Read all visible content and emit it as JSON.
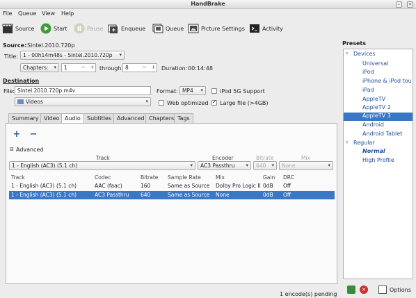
{
  "window": {
    "title": "HandBrake"
  },
  "menu": {
    "file": "File",
    "queue": "Queue",
    "view": "View",
    "help": "Help"
  },
  "toolbar": {
    "source": "Source",
    "start": "Start",
    "pause": "Pause",
    "enqueue": "Enqueue",
    "queue": "Queue",
    "picture_settings": "Picture Settings",
    "activity": "Activity"
  },
  "source": {
    "label": "Source:",
    "value": "Sintel.2010.720p",
    "title_label": "Title:",
    "title_value": "1 - 00h14m48s - Sintel.2010.720p",
    "range_type": "Chapters:",
    "range_start": "1",
    "through_label": "through",
    "range_end": "8",
    "duration_label": "Duration:",
    "duration_value": "00:14:48"
  },
  "destination": {
    "heading": "Destination",
    "file_label": "File:",
    "file_value": "Sintel.2010.720p.m4v",
    "folder": "Videos",
    "format_label": "Format:",
    "format_value": "MP4",
    "ipod_label": "iPod 5G Support",
    "ipod_checked": false,
    "web_label": "Web optimized",
    "web_checked": false,
    "large_label": "Large file (>4GB)",
    "large_checked": true
  },
  "tabs": [
    "Summary",
    "Video",
    "Audio",
    "Subtitles",
    "Advanced",
    "Chapters",
    "Tags"
  ],
  "active_tab": "Audio",
  "audio": {
    "add": "+",
    "remove": "−",
    "advanced_label": "Advanced",
    "headers": {
      "track": "Track",
      "encoder": "Encoder",
      "bitrate": "Bitrate",
      "mix": "Mix"
    },
    "edit": {
      "track": "1 - English (AC3) (5.1 ch)",
      "encoder": "AC3 Passthru",
      "bitrate": "640",
      "mix": "None"
    },
    "columns": [
      "Track",
      "Codec",
      "Bitrate",
      "Sample Rate",
      "Mix",
      "Gain",
      "DRC"
    ],
    "rows": [
      {
        "track": "1 - English (AC3) (5.1 ch)",
        "codec": "AAC (faac)",
        "bitrate": "160",
        "sample_rate": "Same as Source",
        "mix": "Dolby Pro Logic II",
        "gain": "0dB",
        "drc": "Off"
      },
      {
        "track": "1 - English (AC3) (5.1 ch)",
        "codec": "AC3 Passthru",
        "bitrate": "640",
        "sample_rate": "Same as Source",
        "mix": "None",
        "gain": "0dB",
        "drc": "Off"
      }
    ]
  },
  "presets": {
    "heading": "Presets",
    "devices_label": "Devices",
    "devices": [
      "Universal",
      "iPod",
      "iPhone & iPod touch",
      "iPad",
      "AppleTV",
      "AppleTV 2",
      "AppleTV 3",
      "Android",
      "Android Tablet"
    ],
    "selected": "AppleTV 3",
    "regular_label": "Regular",
    "regular": [
      "Normal",
      "High Profile"
    ],
    "options_label": "Options"
  },
  "status": {
    "text": "1 encode(s) pending"
  },
  "colors": {
    "selection": "#3a78c6",
    "link": "#1d4f9a"
  }
}
